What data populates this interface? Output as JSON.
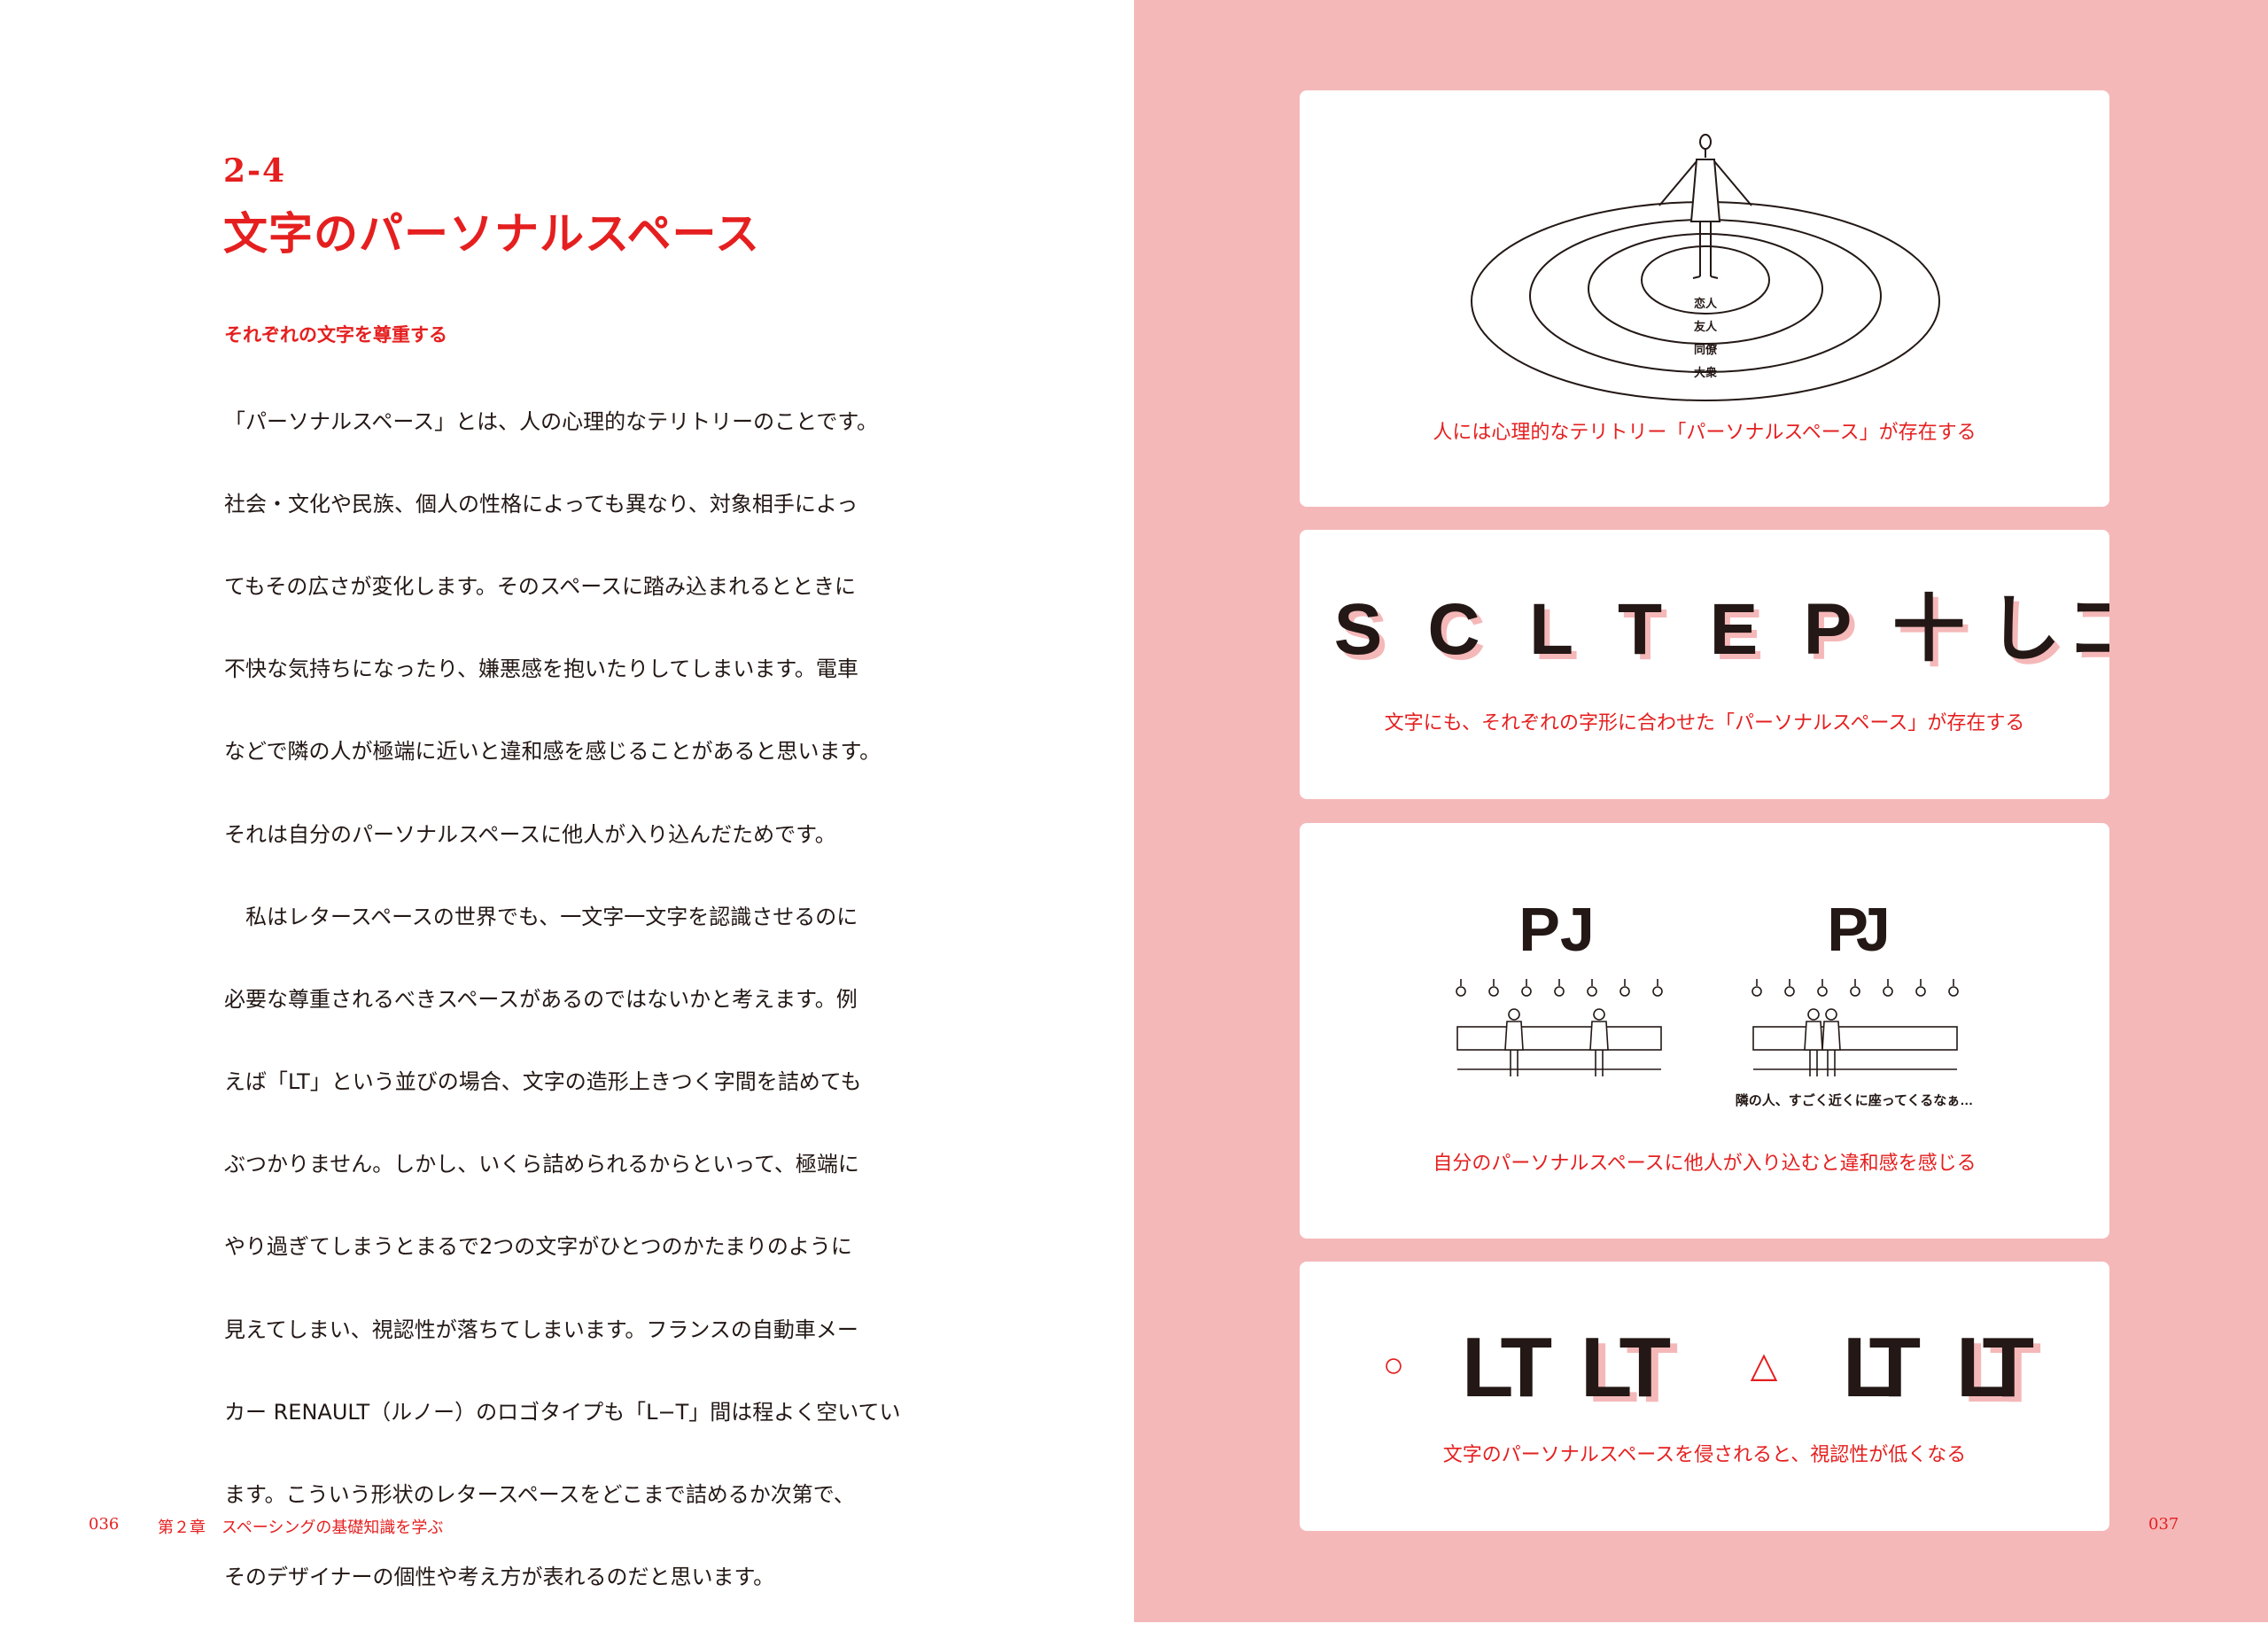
{
  "left_page": {
    "section_number": "2-4",
    "section_title": "文字のパーソナルスペース",
    "subheading": "それぞれの文字を尊重する",
    "body_lines": [
      "「パーソナルスペース」とは、人の心理的なテリトリーのことです。",
      "社会・文化や民族、個人の性格によっても異なり、対象相手によっ",
      "てもその広さが変化します。そのスペースに踏み込まれるとときに",
      "不快な気持ちになったり、嫌悪感を抱いたりしてしまいます。電車",
      "などで隣の人が極端に近いと違和感を感じることがあると思います。",
      "それは自分のパーソナルスペースに他人が入り込んだためです。",
      "　私はレタースペースの世界でも、一文字一文字を認識させるのに",
      "必要な尊重されるべきスペースがあるのではないかと考えます。例",
      "えば「LT」という並びの場合、文字の造形上きつく字間を詰めても",
      "ぶつかりません。しかし、いくら詰められるからといって、極端に",
      "やり過ぎてしまうとまるで2つの文字がひとつのかたまりのように",
      "見えてしまい、視認性が落ちてしまいます。フランスの自動車メー",
      "カー RENAULT（ルノー）のロゴタイプも「L−T」間は程よく空いてい",
      "ます。こういう形状のレタースペースをどこまで詰めるか次第で、",
      "そのデザイナーの個性や考え方が表れるのだと思います。"
    ],
    "folio": "036",
    "chapter_footer": "第２章　スペーシングの基礎知識を学ぶ"
  },
  "right_page": {
    "folio": "037",
    "panel1": {
      "circle_labels": [
        "恋人",
        "友人",
        "同僚",
        "大衆"
      ],
      "caption": "人には心理的なテリトリー「パーソナルスペース」が存在する"
    },
    "panel2": {
      "glyphs": [
        "S",
        "C",
        "L",
        "T",
        "E",
        "P",
        "十",
        "し",
        "コ"
      ],
      "caption": "文字にも、それぞれの字形に合わせた「パーソナルスペース」が存在する"
    },
    "panel3": {
      "pair_left": "PJ",
      "pair_right": "PJ",
      "speech": "隣の人、すごく近くに座ってくるなぁ…",
      "caption": "自分のパーソナルスペースに他人が入り込むと違和感を感じる"
    },
    "panel4": {
      "mark_good": "○",
      "mark_fair": "△",
      "text_a": "LT",
      "text_b": "LT",
      "text_c": "LT",
      "text_d": "LT",
      "caption": "文字のパーソナルスペースを侵されると、視認性が低くなる"
    }
  }
}
